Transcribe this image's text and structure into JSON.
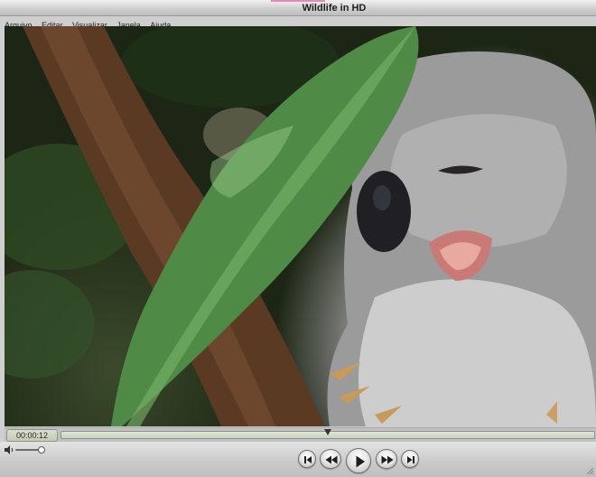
{
  "window": {
    "title": "Wildlife in HD"
  },
  "menu": {
    "items": [
      {
        "label": "Arquivo"
      },
      {
        "label": "Editar"
      },
      {
        "label": "Visualizar"
      },
      {
        "label": "Janela"
      },
      {
        "label": "Ajuda"
      }
    ]
  },
  "player": {
    "current_time": "00:00:12",
    "progress_fraction": 0.5,
    "volume_fraction": 0.92
  },
  "controls": {
    "buttons": [
      {
        "name": "skip-to-start-button",
        "icon": "skip-back-icon"
      },
      {
        "name": "rewind-button",
        "icon": "rewind-icon"
      },
      {
        "name": "play-button",
        "icon": "play-icon"
      },
      {
        "name": "fast-forward-button",
        "icon": "fast-forward-icon"
      },
      {
        "name": "skip-to-end-button",
        "icon": "skip-forward-icon"
      }
    ]
  },
  "colors": {
    "accent": "#e48ab6",
    "time_display_bg": "#d9e0cf",
    "chrome": "#cfcfcf"
  }
}
